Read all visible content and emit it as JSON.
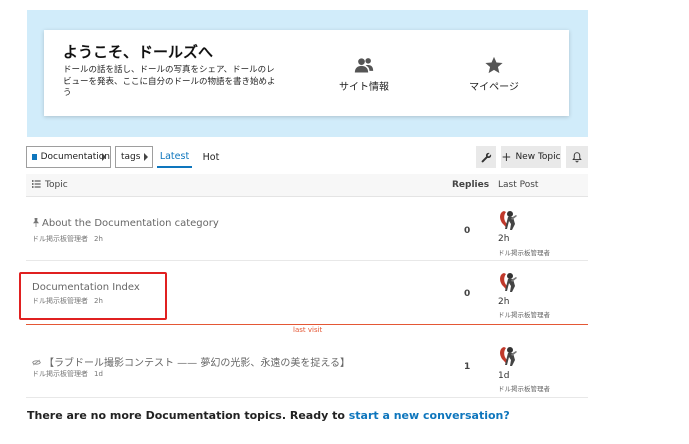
{
  "welcome": {
    "title": "ようこそ、ドールズへ",
    "description": "ドールの話を話し、ドールの写真をシェア、ドールのレビューを発表、ここに自分のドールの物語を書き始めよう",
    "links": [
      {
        "label": "サイト情報",
        "icon": "users-icon"
      },
      {
        "label": "マイページ",
        "icon": "star-icon"
      }
    ]
  },
  "nav": {
    "category": "Documentation",
    "tags": "tags",
    "tabs": [
      "Latest",
      "Hot"
    ],
    "active_tab": "Latest",
    "new_topic": "New Topic"
  },
  "table": {
    "headers": {
      "topic": "Topic",
      "replies": "Replies",
      "last_post": "Last Post"
    },
    "rows": [
      {
        "title": "About the Documentation category",
        "author": "ドル掲示板管理者",
        "age": "2h",
        "replies": "0",
        "last_time": "2h",
        "last_user": "ドル掲示板管理者",
        "pinned": true
      },
      {
        "title": "Documentation Index",
        "author": "ドル掲示板管理者",
        "age": "2h",
        "replies": "0",
        "last_time": "2h",
        "last_user": "ドル掲示板管理者",
        "pinned": false
      },
      {
        "title": "【ラブドール撮影コンテスト —— 夢幻の光影、永遠の美を捉える】",
        "author": "ドル掲示板管理者",
        "age": "1d",
        "replies": "1",
        "last_time": "1d",
        "last_user": "ドル掲示板管理者",
        "pinned": false
      }
    ]
  },
  "last_visit": "last visit",
  "footer": {
    "text": "There are no more Documentation topics. Ready to ",
    "link": "start a new conversation?"
  },
  "colors": {
    "accent": "#0e76bd",
    "banner": "#d1ecfa",
    "last_visit": "#e45735",
    "highlight": "#e02020"
  }
}
